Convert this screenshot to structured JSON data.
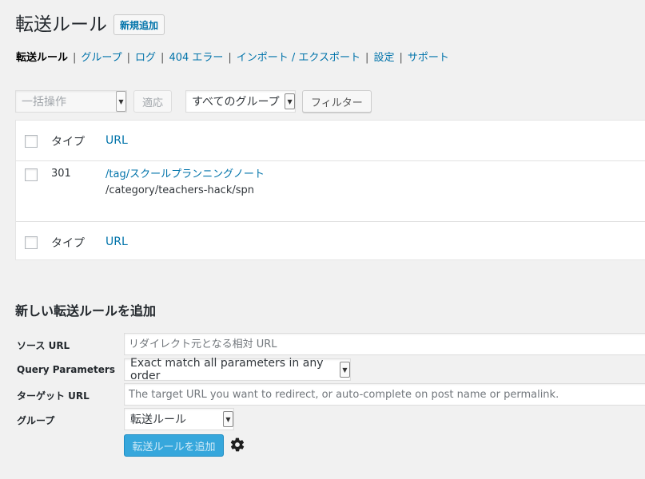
{
  "page": {
    "title": "転送ルール",
    "add_new_label": "新規追加"
  },
  "subnav": {
    "items": [
      "転送ルール",
      "グループ",
      "ログ",
      "404 エラー",
      "インポート / エクスポート",
      "設定",
      "サポート"
    ],
    "separator": "|"
  },
  "tablenav": {
    "bulk_action_placeholder": "一括操作",
    "apply_label": "適応",
    "group_filter_value": "すべてのグループ",
    "filter_button_label": "フィルター"
  },
  "table": {
    "columns": {
      "type": "タイプ",
      "url": "URL"
    },
    "rows": [
      {
        "type": "301",
        "source": "/tag/スクールプランニングノート",
        "target": "/category/teachers-hack/spn"
      }
    ]
  },
  "new_rule": {
    "heading": "新しい転送ルールを追加",
    "source_label": "ソース URL",
    "source_placeholder": "リダイレクト元となる相対 URL",
    "query_label": "Query Parameters",
    "query_value": "Exact match all parameters in any order",
    "target_label": "ターゲット URL",
    "target_placeholder": "The target URL you want to redirect, or auto-complete on post name or permalink.",
    "group_label": "グループ",
    "group_value": "転送ルール",
    "submit_label": "転送ルールを追加"
  },
  "icons": {
    "dropdown": "chevron-down-icon",
    "settings": "gear-icon"
  },
  "colors": {
    "link": "#0073aa",
    "primary_button": "#36a7dc"
  }
}
